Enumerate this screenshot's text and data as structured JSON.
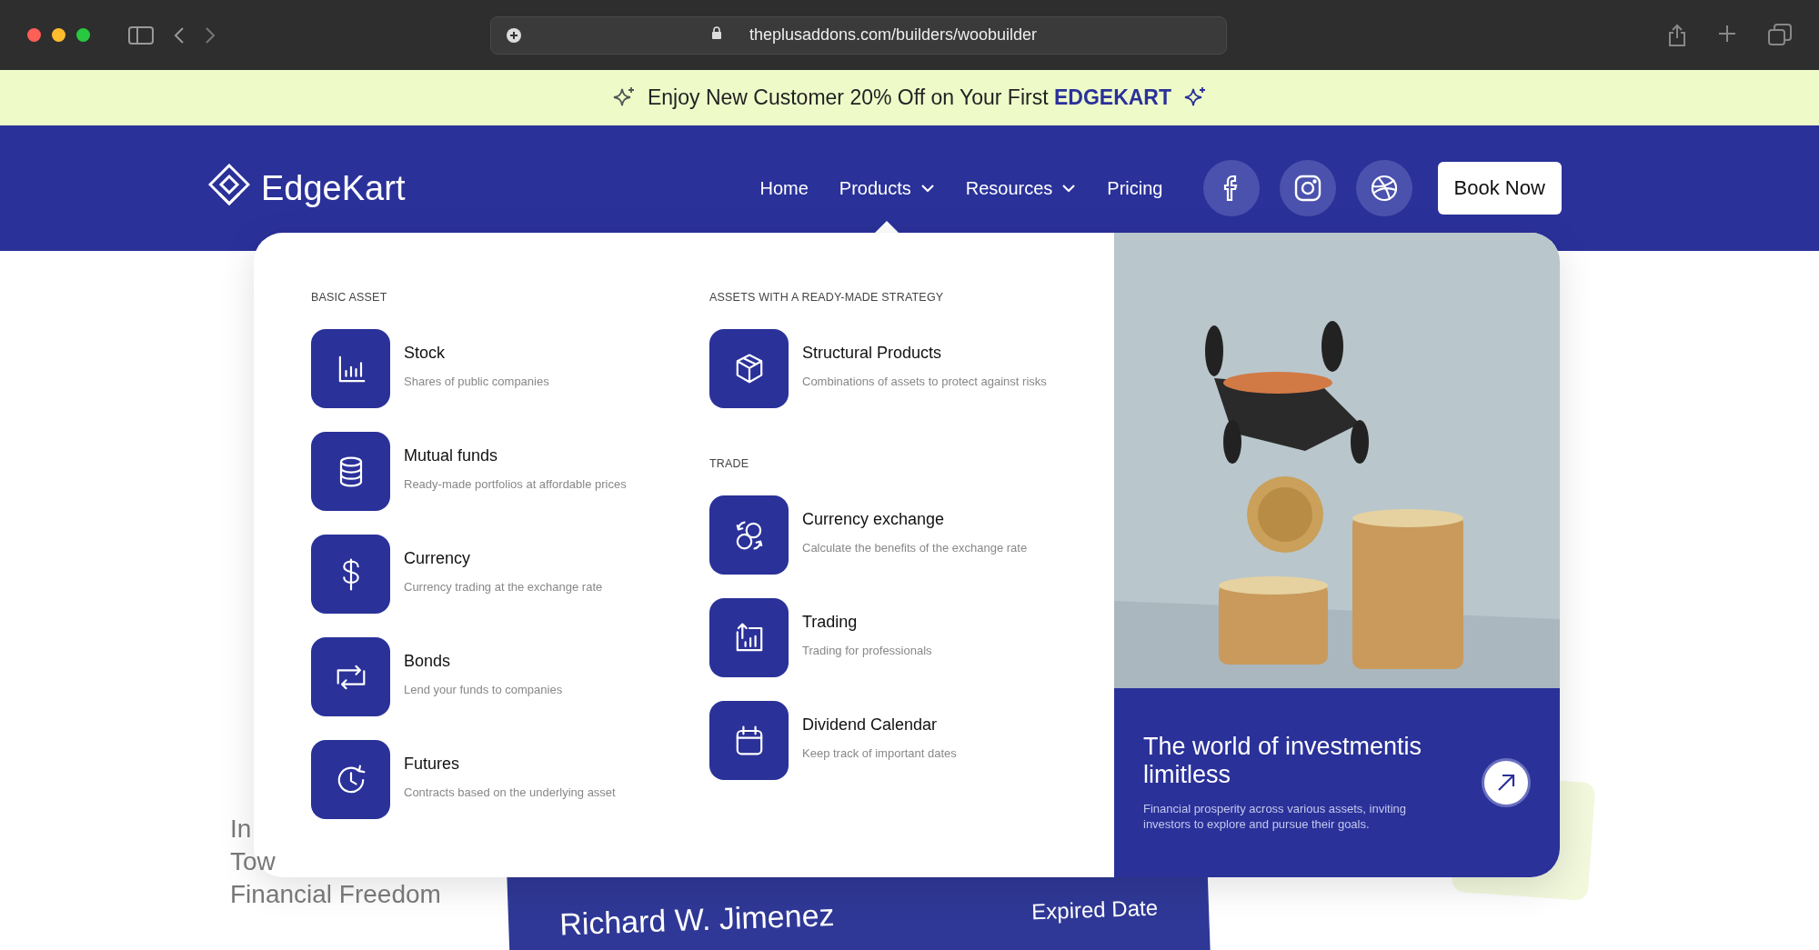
{
  "browser": {
    "url": "theplusaddons.com/builders/woobuilder"
  },
  "promo": {
    "text": "Enjoy New Customer 20% Off on Your First",
    "code": "EDGEKART"
  },
  "header": {
    "brand": "EdgeKart",
    "links": [
      {
        "label": "Home",
        "selected": false,
        "dropdown": false
      },
      {
        "label": "Products",
        "selected": true,
        "dropdown": true
      },
      {
        "label": "Resources",
        "selected": false,
        "dropdown": true
      },
      {
        "label": "Pricing",
        "selected": false,
        "dropdown": false
      }
    ],
    "cta": "Book Now"
  },
  "menu": {
    "columns": [
      {
        "sections": [
          {
            "heading": "BASIC ASSET",
            "items": [
              {
                "title": "Stock",
                "description": "Shares of public companies"
              },
              {
                "title": "Mutual funds",
                "description": "Ready-made portfolios at affordable prices"
              },
              {
                "title": "Currency",
                "description": "Currency trading at the exchange rate"
              },
              {
                "title": "Bonds",
                "description": "Lend your funds to companies"
              },
              {
                "title": "Futures",
                "description": "Contracts based on the underlying asset"
              }
            ]
          }
        ]
      },
      {
        "sections": [
          {
            "heading": "ASSETS WITH A READY-MADE STRATEGY",
            "items": [
              {
                "title": "Structural Products",
                "description": "Combinations of assets to protect against risks"
              }
            ]
          },
          {
            "heading": "TRADE",
            "items": [
              {
                "title": "Currency exchange",
                "description": "Calculate the benefits of the exchange rate"
              },
              {
                "title": "Trading",
                "description": "Trading for professionals"
              },
              {
                "title": "Dividend Calendar",
                "description": "Keep track of important dates"
              }
            ]
          }
        ]
      }
    ],
    "feature": {
      "kind": "picture",
      "title": "The world of investmentis limitless",
      "text": "Financial prosperity across various assets, inviting investors to explore and pursue their goals."
    }
  },
  "hero": {
    "lines": [
      "In",
      "Tow",
      "Financial Freedom"
    ],
    "card": {
      "label": "Expired Date",
      "name": "Richard W. Jimenez"
    }
  }
}
